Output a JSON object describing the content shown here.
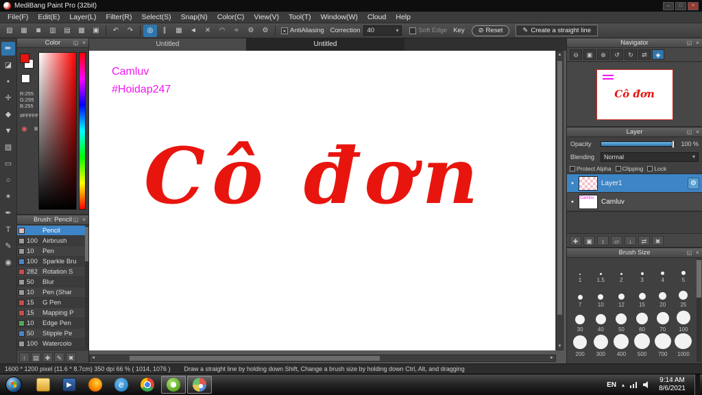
{
  "window": {
    "title": "MediBang Paint Pro (32bit)",
    "minimize": "–",
    "maximize": "□",
    "close": "×"
  },
  "menubar": {
    "items": [
      "File(F)",
      "Edit(E)",
      "Layer(L)",
      "Filter(R)",
      "Select(S)",
      "Snap(N)",
      "Color(C)",
      "View(V)",
      "Tool(T)",
      "Window(W)",
      "Cloud",
      "Help"
    ]
  },
  "toolbar": {
    "antialiasing": "AntiAliasing",
    "correction": "Correction",
    "correction_value": "40",
    "soft_edge": "Soft Edge",
    "key": "Key",
    "reset": "Reset",
    "create_straight_line": "Create a straight line"
  },
  "toolbar_icons": [
    {
      "name": "new-canvas-icon",
      "glyph": "▧"
    },
    {
      "name": "save-icon",
      "glyph": "▦"
    },
    {
      "name": "cloud-upload-icon",
      "glyph": "◙"
    },
    {
      "name": "workspace-icon",
      "glyph": "▥"
    },
    {
      "name": "export-icon",
      "glyph": "▤"
    },
    {
      "name": "grid-view-icon",
      "glyph": "▩"
    },
    {
      "name": "materials-icon",
      "glyph": "▣"
    },
    {
      "name": "undo-icon",
      "glyph": "↶"
    },
    {
      "name": "redo-icon",
      "glyph": "↷"
    },
    {
      "name": "snap-off-icon",
      "glyph": "◎"
    },
    {
      "name": "snap-parallel-icon",
      "glyph": "∥"
    },
    {
      "name": "snap-grid-icon",
      "glyph": "▦"
    },
    {
      "name": "snap-vanishing-point-icon",
      "glyph": "◄"
    },
    {
      "name": "snap-cross-icon",
      "glyph": "✕"
    },
    {
      "name": "snap-ellipse-icon",
      "glyph": "◠"
    },
    {
      "name": "snap-curve-icon",
      "glyph": "≈"
    },
    {
      "name": "snap-settings-icon",
      "glyph": "⚙"
    },
    {
      "name": "tool-settings-icon",
      "glyph": "⚙"
    }
  ],
  "tools": [
    {
      "name": "brush-tool",
      "glyph": "✏"
    },
    {
      "name": "eraser-tool",
      "glyph": "◪"
    },
    {
      "name": "pixel-tool",
      "glyph": "▪"
    },
    {
      "name": "move-tool",
      "glyph": "✛"
    },
    {
      "name": "fill-tool",
      "glyph": "◆"
    },
    {
      "name": "bucket-tool",
      "glyph": "▼"
    },
    {
      "name": "gradient-tool",
      "glyph": "▨"
    },
    {
      "name": "select-tool",
      "glyph": "▭"
    },
    {
      "name": "lasso-tool",
      "glyph": "○"
    },
    {
      "name": "magic-wand-tool",
      "glyph": "✶"
    },
    {
      "name": "select-pen-tool",
      "glyph": "✒"
    },
    {
      "name": "text-tool",
      "glyph": "T"
    },
    {
      "name": "eyedropper-tool",
      "glyph": "✎"
    },
    {
      "name": "hand-tool",
      "glyph": "◉"
    }
  ],
  "tabs": {
    "tab1": "Untitled",
    "tab2": "Untitled"
  },
  "canvas": {
    "line1": "Camluv",
    "line2": "#Hoidap247",
    "artwork_text": "Cô đơn",
    "artwork_color": "#e8150e",
    "caption_color": "#f414f4"
  },
  "color_panel": {
    "title": "Color",
    "r": "R:255",
    "g": "G:255",
    "b": "B:255",
    "hex": "#FFFFFF",
    "foreground": "#e8150e",
    "background": "#ffffff"
  },
  "brush_panel": {
    "title": "Brush: Pencil",
    "brushes": [
      {
        "size": "",
        "name": "Pencil",
        "swatch": "#e8b8b8"
      },
      {
        "size": "100",
        "name": "Airbrush",
        "swatch": "#9a9a9a"
      },
      {
        "size": "10",
        "name": "Pen",
        "swatch": "#9a9a9a"
      },
      {
        "size": "100",
        "name": "Sparkle Bru",
        "swatch": "#4d86c6"
      },
      {
        "size": "282",
        "name": "Rotation S",
        "swatch": "#c64d4d"
      },
      {
        "size": "50",
        "name": "Blur",
        "swatch": "#9a9a9a"
      },
      {
        "size": "10",
        "name": "Pen (Shar",
        "swatch": "#9a9a9a"
      },
      {
        "size": "15",
        "name": "G Pen",
        "swatch": "#c64d4d"
      },
      {
        "size": "15",
        "name": "Mapping P",
        "swatch": "#c64d4d"
      },
      {
        "size": "10",
        "name": "Edge Pen",
        "swatch": "#56a856"
      },
      {
        "size": "50",
        "name": "Stipple Pe",
        "swatch": "#4d86c6"
      },
      {
        "size": "100",
        "name": "Watercolo",
        "swatch": "#9a9a9a"
      }
    ]
  },
  "navigator": {
    "title": "Navigator"
  },
  "navigator_icons": [
    {
      "name": "zoom-out-icon",
      "glyph": "⊖"
    },
    {
      "name": "zoom-fit-icon",
      "glyph": "▣"
    },
    {
      "name": "zoom-in-icon",
      "glyph": "⊕"
    },
    {
      "name": "rotate-left-icon",
      "glyph": "↺"
    },
    {
      "name": "rotate-right-icon",
      "glyph": "↻"
    },
    {
      "name": "reset-view-icon",
      "glyph": "⇄"
    },
    {
      "name": "flip-view-icon",
      "glyph": "◈"
    }
  ],
  "layer_panel": {
    "title": "Layer",
    "opacity_label": "Opacity",
    "opacity_value": "100 %",
    "blending_label": "Blending",
    "blending_value": "Normal",
    "protect_alpha": "Protect Alpha",
    "clipping": "Clipping",
    "lock": "Lock",
    "layers": [
      {
        "name": "Layer1"
      },
      {
        "name": "Camluv"
      }
    ]
  },
  "layer_icons": [
    {
      "name": "new-layer-icon",
      "glyph": "✚"
    },
    {
      "name": "duplicate-layer-icon",
      "glyph": "▣"
    },
    {
      "name": "layer-order-icon",
      "glyph": "↕"
    },
    {
      "name": "layer-folder-icon",
      "glyph": "▱"
    },
    {
      "name": "merge-layer-icon",
      "glyph": "↓"
    },
    {
      "name": "transfer-layer-icon",
      "glyph": "⇄"
    },
    {
      "name": "delete-layer-icon",
      "glyph": "✖"
    }
  ],
  "brush_footer_icons": [
    {
      "name": "brush-scroll-up-icon",
      "glyph": "↑"
    },
    {
      "name": "brush-menu-icon",
      "glyph": "▤"
    },
    {
      "name": "add-brush-icon",
      "glyph": "✚"
    },
    {
      "name": "edit-brush-icon",
      "glyph": "✎"
    },
    {
      "name": "delete-brush-icon",
      "glyph": "✖"
    }
  ],
  "brush_size_panel": {
    "title": "Brush Size",
    "sizes": [
      "1",
      "1.5",
      "2",
      "3",
      "4",
      "5",
      "7",
      "10",
      "12",
      "15",
      "20",
      "25",
      "30",
      "40",
      "50",
      "60",
      "70",
      "100",
      "200",
      "300",
      "400",
      "500",
      "700",
      "1000"
    ]
  },
  "statusbar": {
    "info": "1600 * 1200 pixel   (11.6 * 8.7cm)   350 dpi   66 %   ( 1014, 1076 )",
    "hint": "Draw a straight line by holding down Shift, Change a brush size by holding down Ctrl, Alt, and dragging"
  },
  "taskbar": {
    "language": "EN",
    "time": "9:14 AM",
    "date": "8/6/2021",
    "icons": [
      "file-explorer-icon",
      "media-player-icon",
      "firefox-icon",
      "internet-explorer-icon",
      "chrome-icon",
      "medibang-icon",
      "paint-app-icon"
    ]
  },
  "ui": {
    "popout": "◱",
    "close": "×",
    "chevron_down": "▾",
    "check": "×",
    "slash": "⊘",
    "pen": "✎",
    "dot": "●",
    "gear": "⚙",
    "hidden_icons": "▴",
    "scroll_up": "▲",
    "scroll_down": "▼",
    "scroll_left": "◄",
    "scroll_right": "►"
  },
  "colors": {
    "accent_blue": "#2f76ad",
    "selection_blue": "#3d85c6"
  }
}
